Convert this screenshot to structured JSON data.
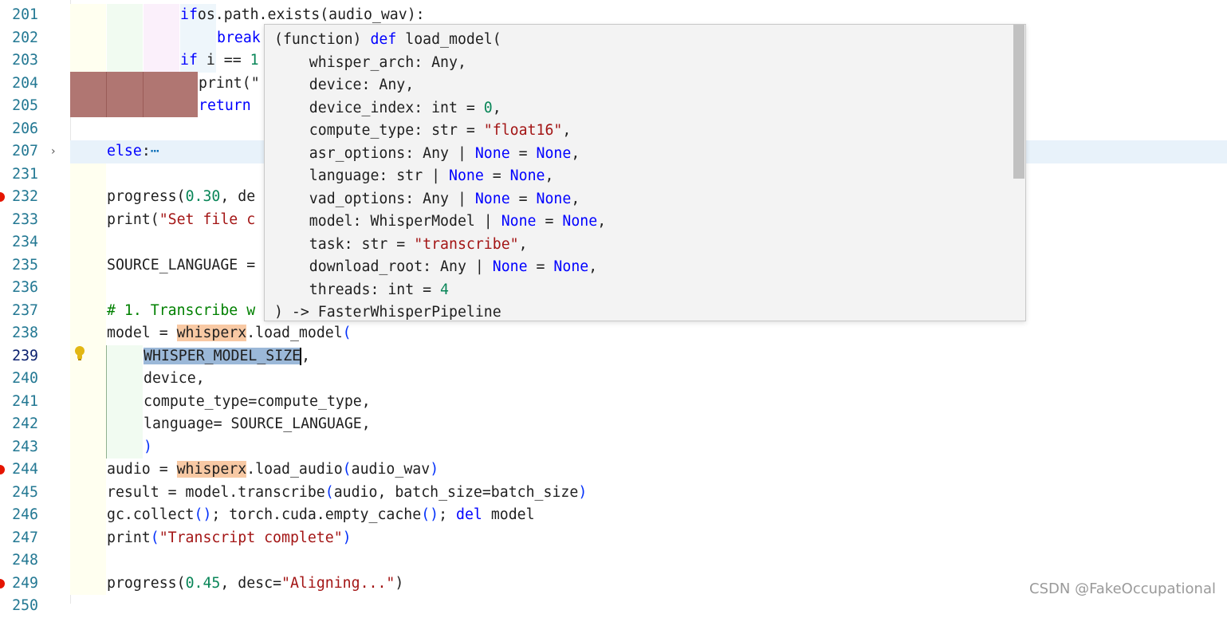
{
  "editor": {
    "lines": [
      {
        "n": "201",
        "tokens": [
          [
            "kw",
            "if"
          ],
          [
            "",
            "os.path.exists(audio_wav):"
          ]
        ]
      },
      {
        "n": "202",
        "tokens": [
          [
            "kw",
            "break"
          ]
        ]
      },
      {
        "n": "203",
        "tokens": [
          [
            "kw",
            "if"
          ],
          [
            "",
            " i == "
          ],
          [
            "num",
            "1"
          ]
        ]
      },
      {
        "n": "204",
        "tokens": [
          [
            "",
            "print(\""
          ]
        ]
      },
      {
        "n": "205",
        "tokens": [
          [
            "kw",
            "return"
          ]
        ]
      },
      {
        "n": "206",
        "tokens": []
      },
      {
        "n": "207",
        "tokens": [
          [
            "kw",
            "else"
          ],
          [
            "",
            ":"
          ],
          [
            "collapsed",
            "⋯"
          ]
        ]
      },
      {
        "n": "231",
        "tokens": []
      },
      {
        "n": "232",
        "tokens": [
          [
            "",
            "progress("
          ],
          [
            "num",
            "0.30"
          ],
          [
            "",
            ", de"
          ]
        ]
      },
      {
        "n": "233",
        "tokens": [
          [
            "",
            "print("
          ],
          [
            "str",
            "\"Set file c"
          ]
        ]
      },
      {
        "n": "234",
        "tokens": []
      },
      {
        "n": "235",
        "tokens": [
          [
            "",
            "SOURCE_LANGUAGE ="
          ]
        ]
      },
      {
        "n": "236",
        "tokens": []
      },
      {
        "n": "237",
        "tokens": [
          [
            "cm",
            "# 1. Transcribe w"
          ]
        ]
      },
      {
        "n": "238",
        "tokens": [
          [
            "",
            "model = "
          ],
          [
            "hlmod",
            "whisperx"
          ],
          [
            "",
            ".load_model"
          ],
          [
            "pn",
            "("
          ]
        ]
      },
      {
        "n": "239",
        "tokens": [
          [
            "sel",
            "WHISPER_MODEL_SIZE"
          ],
          [
            "caret",
            ""
          ],
          [
            "",
            ","
          ]
        ]
      },
      {
        "n": "240",
        "tokens": [
          [
            "",
            "device,"
          ]
        ]
      },
      {
        "n": "241",
        "tokens": [
          [
            "",
            "compute_type=compute_type,"
          ]
        ]
      },
      {
        "n": "242",
        "tokens": [
          [
            "",
            "language= SOURCE_LANGUAGE,"
          ]
        ]
      },
      {
        "n": "243",
        "tokens": [
          [
            "pn",
            ")"
          ]
        ]
      },
      {
        "n": "244",
        "tokens": [
          [
            "",
            "audio = "
          ],
          [
            "hlmod",
            "whisperx"
          ],
          [
            "",
            ".load_audio"
          ],
          [
            "pn",
            "("
          ],
          [
            "",
            "audio_wav"
          ],
          [
            "pn",
            ")"
          ]
        ]
      },
      {
        "n": "245",
        "tokens": [
          [
            "",
            "result = model.transcribe"
          ],
          [
            "pn",
            "("
          ],
          [
            "",
            "audio, batch_size=batch_size"
          ],
          [
            "pn",
            ")"
          ]
        ]
      },
      {
        "n": "246",
        "tokens": [
          [
            "",
            "gc.collect"
          ],
          [
            "pn",
            "()"
          ],
          [
            "",
            "; torch.cuda.empty_cache"
          ],
          [
            "pn",
            "()"
          ],
          [
            "",
            "; "
          ],
          [
            "kw",
            "del"
          ],
          [
            "",
            " model"
          ]
        ]
      },
      {
        "n": "247",
        "tokens": [
          [
            "",
            "print"
          ],
          [
            "pn",
            "("
          ],
          [
            "str",
            "\"Transcript complete\""
          ],
          [
            "pn",
            ")"
          ]
        ]
      },
      {
        "n": "248",
        "tokens": []
      },
      {
        "n": "249",
        "tokens": [
          [
            "",
            "progress("
          ],
          [
            "num",
            "0.45"
          ],
          [
            "",
            ", desc="
          ],
          [
            "str",
            "\"Aligning...\""
          ],
          [
            "",
            ")"
          ]
        ]
      },
      {
        "n": "250",
        "tokens": []
      }
    ]
  },
  "hover": {
    "lines": [
      [
        [
          "",
          "(function) "
        ],
        [
          "kw",
          "def"
        ],
        [
          "",
          " load_model("
        ]
      ],
      [
        [
          "",
          "    whisper_arch: Any,"
        ]
      ],
      [
        [
          "",
          "    device: Any,"
        ]
      ],
      [
        [
          "",
          "    device_index: int = "
        ],
        [
          "num",
          "0"
        ],
        [
          "",
          ","
        ]
      ],
      [
        [
          "",
          "    compute_type: str = "
        ],
        [
          "str",
          "\"float16\""
        ],
        [
          "",
          ","
        ]
      ],
      [
        [
          "",
          "    asr_options: Any | "
        ],
        [
          "kw",
          "None"
        ],
        [
          "",
          " = "
        ],
        [
          "kw",
          "None"
        ],
        [
          "",
          ","
        ]
      ],
      [
        [
          "",
          "    language: str | "
        ],
        [
          "kw",
          "None"
        ],
        [
          "",
          " = "
        ],
        [
          "kw",
          "None"
        ],
        [
          "",
          ","
        ]
      ],
      [
        [
          "",
          "    vad_options: Any | "
        ],
        [
          "kw",
          "None"
        ],
        [
          "",
          " = "
        ],
        [
          "kw",
          "None"
        ],
        [
          "",
          ","
        ]
      ],
      [
        [
          "",
          "    model: WhisperModel | "
        ],
        [
          "kw",
          "None"
        ],
        [
          "",
          " = "
        ],
        [
          "kw",
          "None"
        ],
        [
          "",
          ","
        ]
      ],
      [
        [
          "",
          "    task: str = "
        ],
        [
          "str",
          "\"transcribe\""
        ],
        [
          "",
          ","
        ]
      ],
      [
        [
          "",
          "    download_root: Any | "
        ],
        [
          "kw",
          "None"
        ],
        [
          "",
          " = "
        ],
        [
          "kw",
          "None"
        ],
        [
          "",
          ","
        ]
      ],
      [
        [
          "",
          "    threads: int = "
        ],
        [
          "num",
          "4"
        ]
      ],
      [
        [
          "",
          ") -> FasterWhisperPipeline"
        ]
      ]
    ]
  },
  "watermark": "CSDN @FakeOccupational",
  "colors": {
    "keyword": "#0000ff",
    "string": "#a31515",
    "number": "#098658",
    "comment": "#008000",
    "line_number": "#237893",
    "breakpoint": "#e51400"
  }
}
